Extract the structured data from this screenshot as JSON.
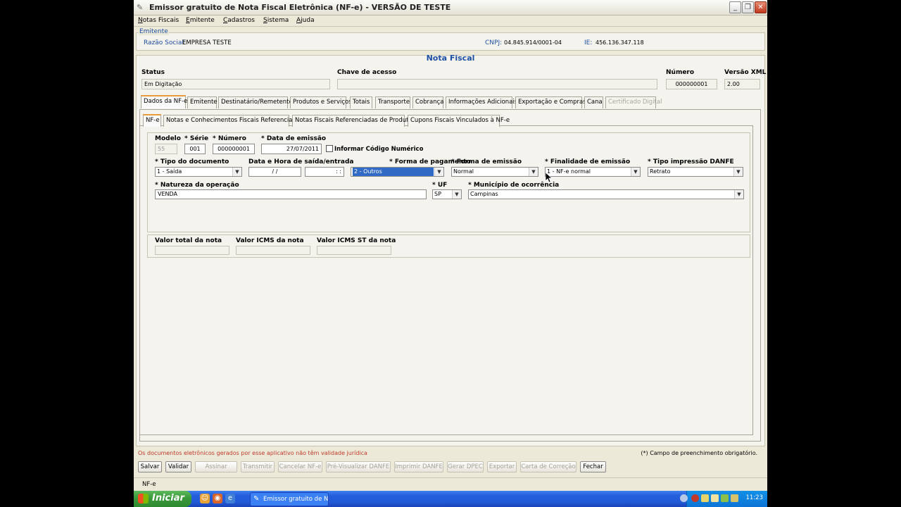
{
  "window": {
    "title": "Emissor gratuito de Nota Fiscal Eletrônica (NF-e) - VERSÃO DE TESTE"
  },
  "menu": [
    "Notas Fiscais",
    "Emitente",
    "Cadastros",
    "Sistema",
    "Ajuda"
  ],
  "emitente": {
    "legend": "Emitente",
    "razao_label": "Razão Social:",
    "razao": "EMPRESA TESTE",
    "cnpj_label": "CNPJ:",
    "cnpj": "04.845.914/0001-04",
    "ie_label": "IE:",
    "ie": "456.136.347.118"
  },
  "nota": {
    "title": "Nota Fiscal",
    "status_label": "Status",
    "status": "Em Digitação",
    "chave_label": "Chave de acesso",
    "chave": "",
    "numero_label": "Número",
    "numero": "000000001",
    "versao_label": "Versão XML",
    "versao": "2.00"
  },
  "tabs": [
    "Dados da NF-e",
    "Emitente",
    "Destinatário/Remetente",
    "Produtos e Serviços",
    "Totais",
    "Transporte",
    "Cobrança",
    "Informações Adicionais",
    "Exportação e Compras",
    "Cana",
    "Certificado Digital"
  ],
  "subtabs": [
    "NF-e",
    "Notas e Conhecimentos Fiscais Referenciados",
    "Notas Fiscais Referenciadas de Produtor",
    "Cupons Fiscais Vinculados à NF-e"
  ],
  "form": {
    "modelo_label": "Modelo",
    "modelo": "55",
    "serie_label": "* Série",
    "serie": "001",
    "numero_label": "* Número",
    "numero": "000000001",
    "data_emissao_label": "* Data de emissão",
    "data_emissao": "27/07/2011",
    "codigo_numerico_label": "Informar Código Numérico",
    "tipo_doc_label": "* Tipo do documento",
    "tipo_doc": "1 - Saída",
    "data_hora_label": "Data e Hora de saída/entrada",
    "data_saida": "/ /",
    "hora_saida": ": :",
    "forma_pag_label": "* Forma de pagamento",
    "forma_pag": "2 - Outros",
    "forma_emissao_label": "* Forma de emissão",
    "forma_emissao": "Normal",
    "finalidade_label": "* Finalidade de emissão",
    "finalidade": "1 - NF-e normal",
    "tipo_danfe_label": "* Tipo impressão DANFE",
    "tipo_danfe": "Retrato",
    "natureza_label": "* Natureza da operação",
    "natureza": "VENDA",
    "uf_label": "* UF",
    "uf": "SP",
    "municipio_label": "* Município de ocorrência",
    "municipio": "Campinas"
  },
  "totals": {
    "valor_total_label": "Valor total da nota",
    "valor_icms_label": "Valor ICMS da nota",
    "valor_icms_st_label": "Valor ICMS ST da nota"
  },
  "footer": {
    "warning": "Os documentos eletrônicos gerados por esse aplicativo não têm validade jurídica",
    "required_note": "(*) Campo de preenchimento obrigatório."
  },
  "buttons": [
    "Salvar",
    "Validar",
    "Assinar",
    "Transmitir",
    "Cancelar NF-e",
    "Pré-Visualizar DANFE",
    "Imprimir DANFE",
    "Gerar DPEC",
    "Exportar",
    "Carta de Correção",
    "Fechar"
  ],
  "statusbar": "NF-e",
  "taskbar": {
    "start": "Iniciar",
    "task": "Emissor gratuito de N...",
    "clock": "11:23"
  }
}
